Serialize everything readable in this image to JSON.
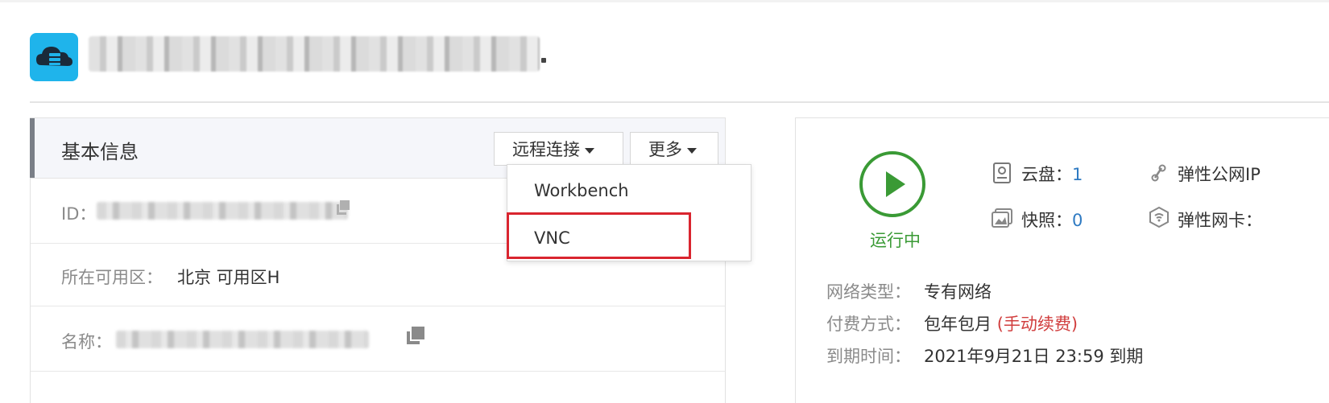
{
  "header": {
    "icon": "cloud-server-icon",
    "title_redacted": true
  },
  "basic_info": {
    "title": "基本信息",
    "remote_connect_label": "远程连接",
    "more_label": "更多",
    "rows": {
      "id_label": "ID：",
      "zone_label": "所在可用区：",
      "zone_value": "北京 可用区H",
      "name_label": "名称："
    }
  },
  "remote_menu": {
    "items": [
      "Workbench",
      "VNC"
    ],
    "highlighted": "VNC"
  },
  "status": {
    "state": "运行中",
    "color": "#3a9a35"
  },
  "resources": {
    "disk_label": "云盘：",
    "disk_count": "1",
    "snapshot_label": "快照：",
    "snapshot_count": "0",
    "eip_label": "弹性公网IP",
    "eni_label": "弹性网卡："
  },
  "details": {
    "network_type_label": "网络类型：",
    "network_type_value": "专有网络",
    "billing_label": "付费方式：",
    "billing_value": "包年包月",
    "billing_note": "(手动续费)",
    "expiry_label": "到期时间：",
    "expiry_value": "2021年9月21日 23:59 到期"
  },
  "colors": {
    "accent_blue": "#1fb4eb",
    "link_blue": "#2e7ac2",
    "highlight_red": "#d9252f",
    "renew_red": "#d13e3e"
  }
}
